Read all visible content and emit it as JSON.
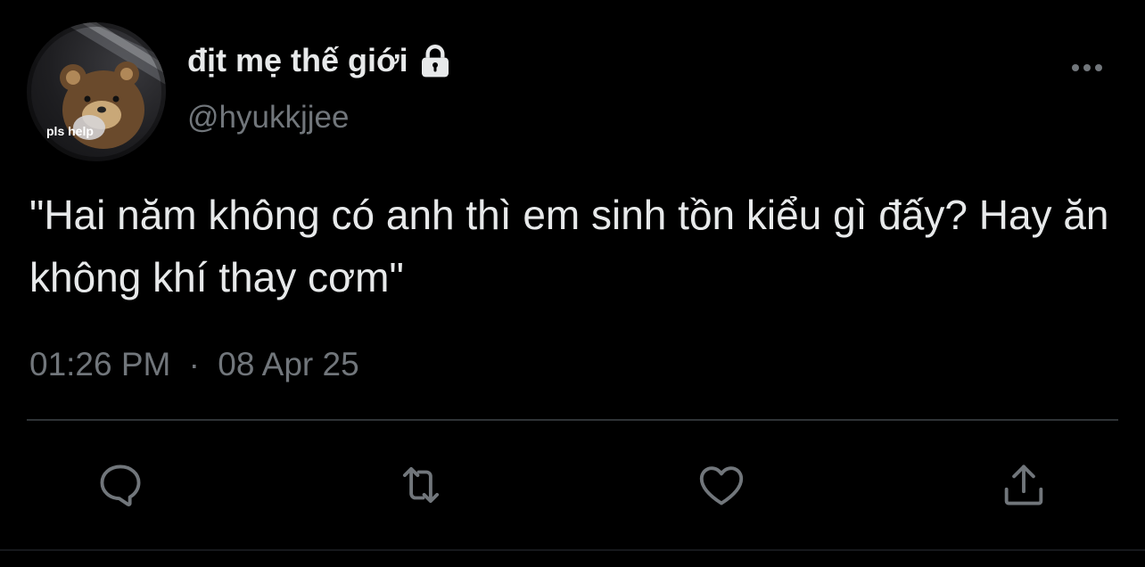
{
  "author": {
    "display_name": "địt mẹ thế giới",
    "handle": "@hyukkjjee",
    "avatar_caption": "pls help",
    "avatar_icon": "teddy-bear-avatar",
    "protected_icon": "lock-icon"
  },
  "tweet": {
    "text": "\"Hai năm không có anh thì em sinh tồn kiểu gì đấy? Hay ăn không khí thay cơm\"",
    "time": "01:26 PM",
    "separator": "·",
    "date": "08 Apr 25"
  },
  "actions": [
    {
      "name": "reply",
      "icon": "speech-bubble-icon"
    },
    {
      "name": "retweet",
      "icon": "retweet-arrows-icon"
    },
    {
      "name": "like",
      "icon": "heart-icon"
    },
    {
      "name": "share",
      "icon": "share-upload-icon"
    }
  ],
  "menu": {
    "icon": "more-horizontal-icon"
  },
  "colors": {
    "background": "#000000",
    "primary_text": "#e7e9ea",
    "secondary_text": "#71767b",
    "divider": "#2f3336"
  }
}
